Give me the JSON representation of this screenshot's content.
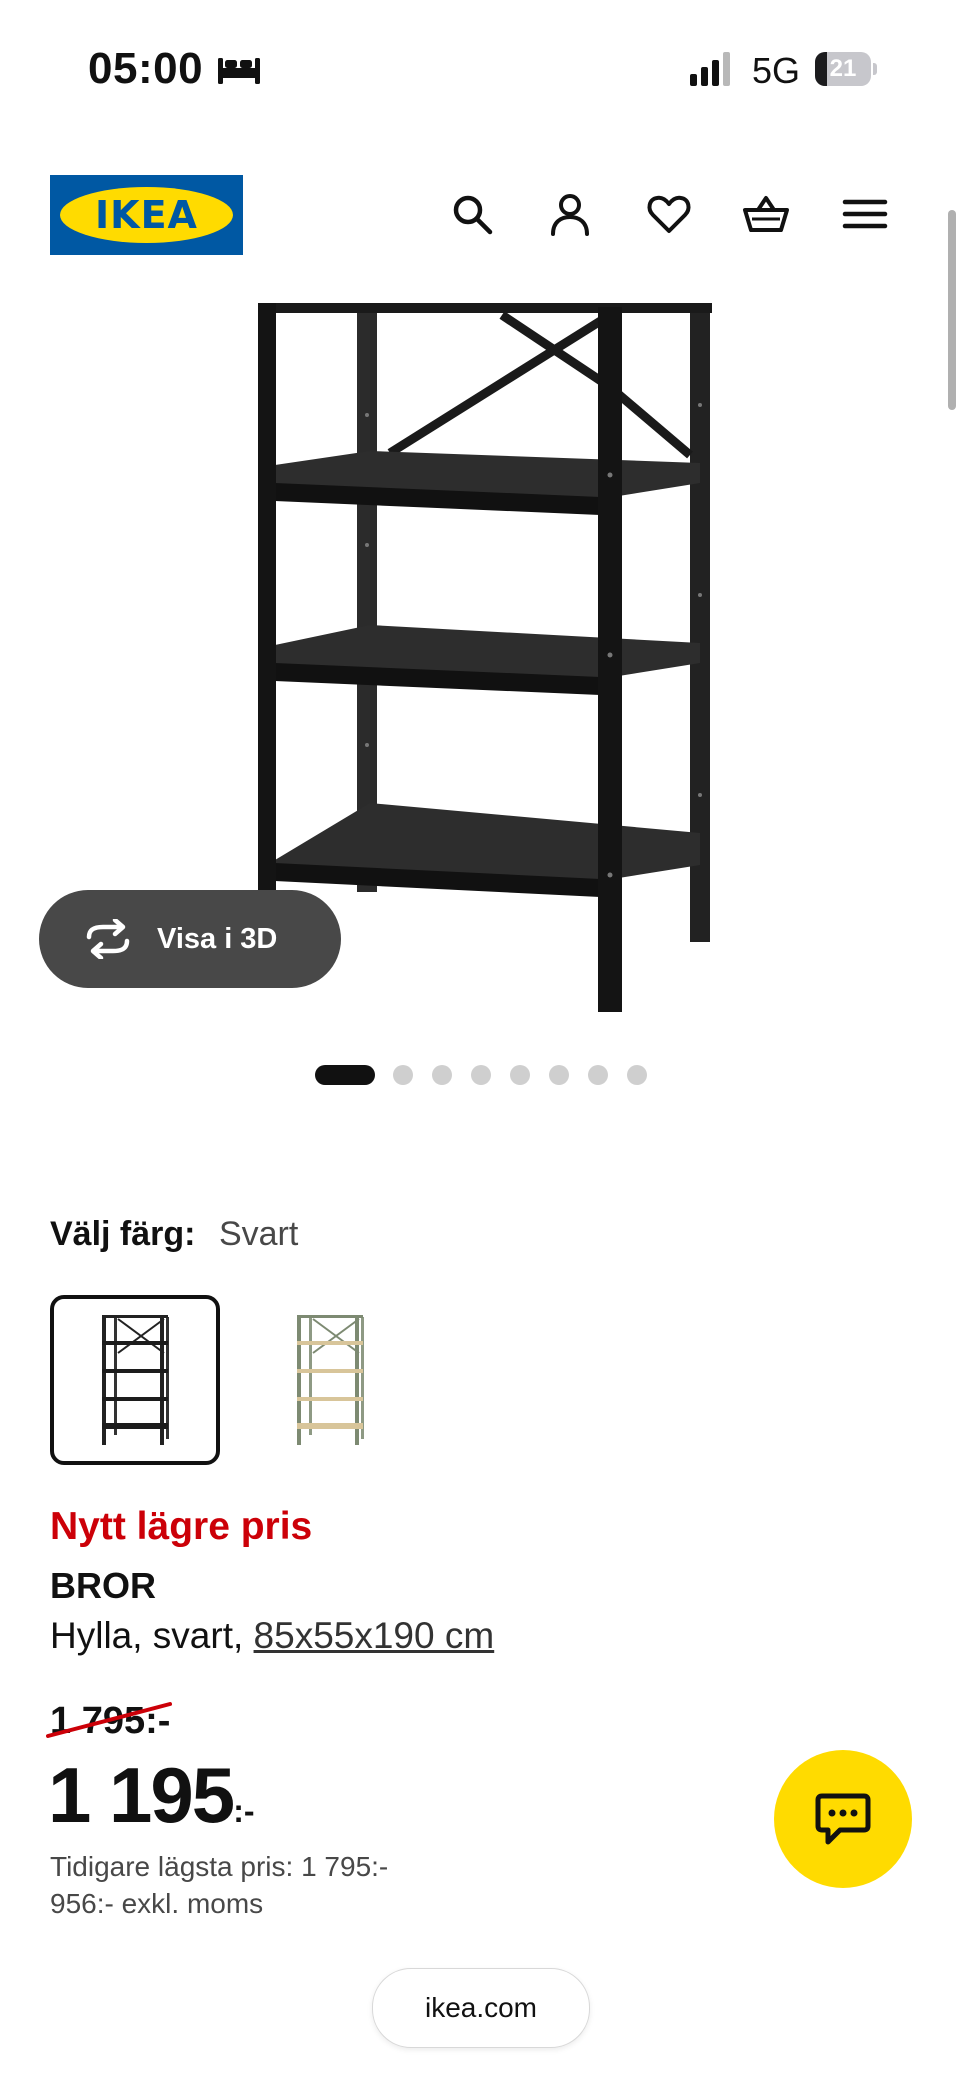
{
  "status_bar": {
    "time": "05:00",
    "network": "5G",
    "battery_level": "21",
    "battery_fraction": 0.21,
    "icons": [
      "bed-icon",
      "signal-icon",
      "battery-icon"
    ]
  },
  "header": {
    "logo_text": "IKEA",
    "icons": [
      "search-icon",
      "account-icon",
      "heart-icon",
      "basket-icon",
      "menu-icon"
    ],
    "colors": {
      "brand_blue": "#0058a3",
      "brand_yellow": "#ffdb00"
    }
  },
  "gallery": {
    "view_3d_label": "Visa i 3D",
    "image_count": 8,
    "active_index": 0
  },
  "color_selector": {
    "label": "Välj färg:",
    "selected_value": "Svart",
    "options": [
      "Svart",
      "Grön/trä"
    ]
  },
  "product": {
    "promo_label": "Nytt lägre pris",
    "name": "BROR",
    "description": "Hylla, svart,",
    "size": "85x55x190 cm",
    "old_price": "1 795:-",
    "price_number": "1 195",
    "price_suffix": ":-",
    "lowest_price": "Tidigare lägsta pris: 1 795:-",
    "excl_vat": "956:- exkl. moms",
    "promo_color": "#cc0008"
  },
  "chat": {
    "icon": "chat-icon"
  },
  "browser": {
    "url": "ikea.com"
  }
}
